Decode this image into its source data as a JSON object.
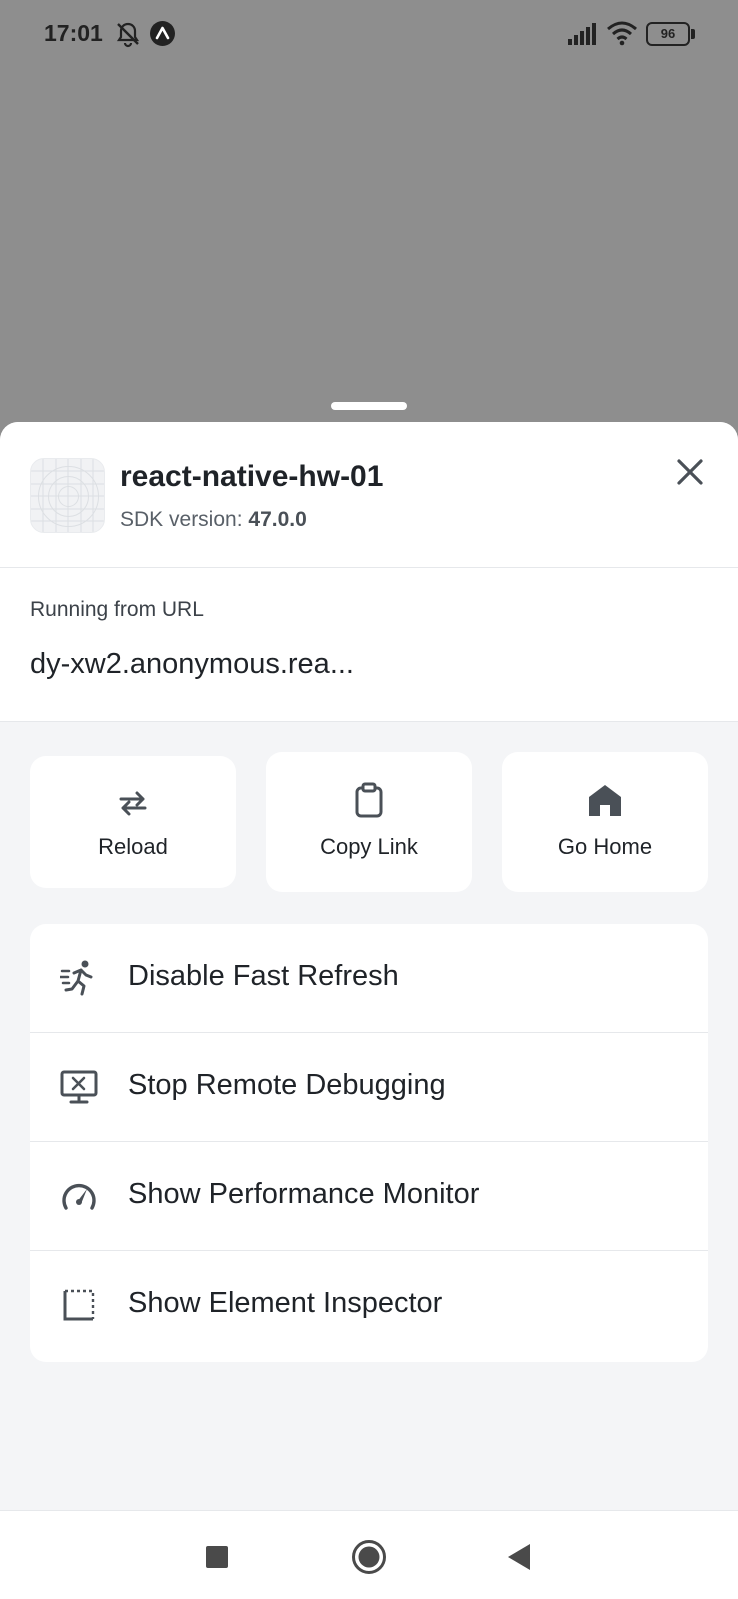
{
  "status_bar": {
    "time": "17:01",
    "battery": "96",
    "icons": [
      "mute-icon",
      "app-notification-icon",
      "signal-icon",
      "wifi-icon",
      "battery-icon"
    ]
  },
  "sheet": {
    "app_name": "react-native-hw-01",
    "sdk_label": "SDK version: ",
    "sdk_version": "47.0.0",
    "url_label": "Running from URL",
    "url_value": "dy-xw2.anonymous.rea..."
  },
  "actions": [
    {
      "label": "Reload",
      "icon": "reload-icon"
    },
    {
      "label": "Copy Link",
      "icon": "clipboard-icon"
    },
    {
      "label": "Go Home",
      "icon": "home-icon"
    }
  ],
  "menu": [
    {
      "label": "Disable Fast Refresh",
      "icon": "running-person-icon"
    },
    {
      "label": "Stop Remote Debugging",
      "icon": "debug-monitor-icon"
    },
    {
      "label": "Show Performance Monitor",
      "icon": "speedometer-icon"
    },
    {
      "label": "Show Element Inspector",
      "icon": "inspector-icon"
    }
  ],
  "colors": {
    "backdrop": "#8e8e8e",
    "sheet_bg": "#f4f5f7",
    "card_bg": "#ffffff",
    "text_primary": "#1f2328",
    "icon_color": "#4a5057"
  }
}
